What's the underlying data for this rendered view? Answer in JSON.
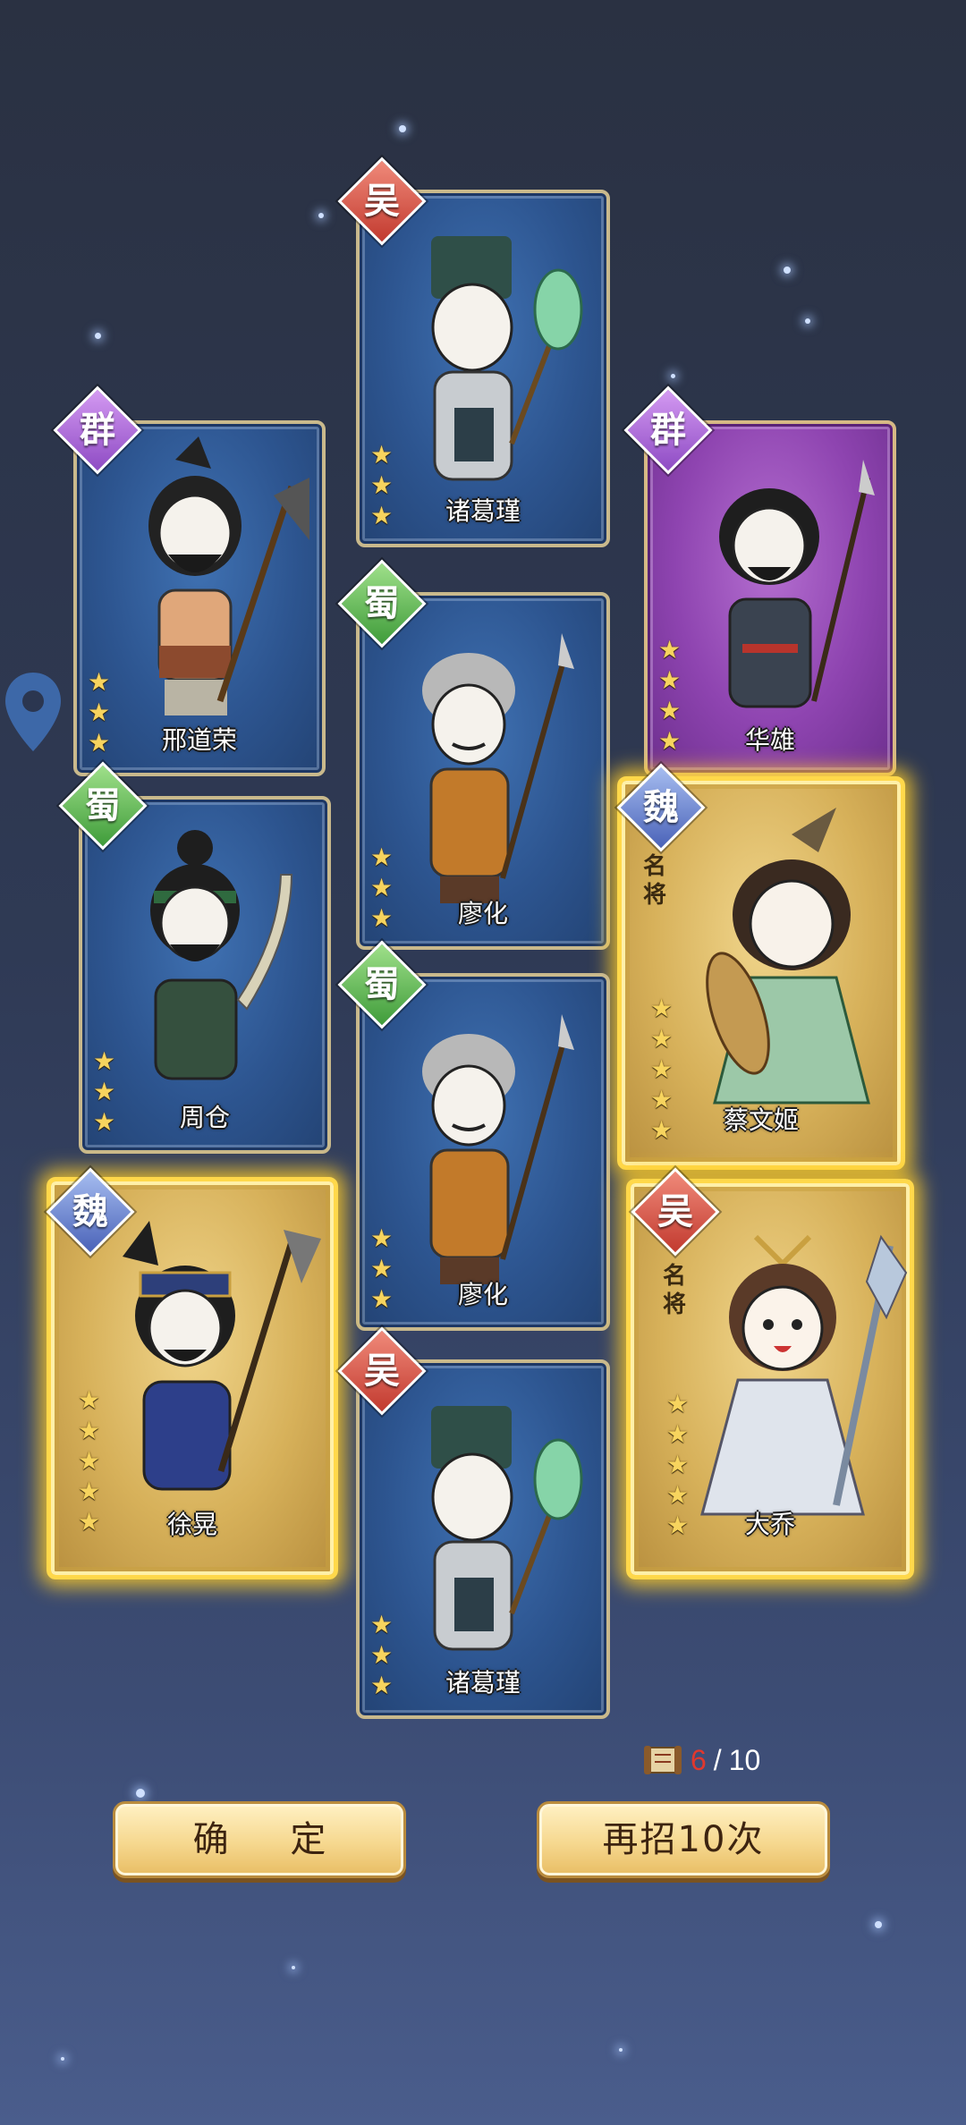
{
  "cards": [
    {
      "id": "c1",
      "name": "诸葛瑾",
      "faction": "吴",
      "frame": "blue",
      "stars": 3,
      "featured": false
    },
    {
      "id": "c2",
      "name": "邢道荣",
      "faction": "群",
      "frame": "blue",
      "stars": 3,
      "featured": false
    },
    {
      "id": "c3",
      "name": "华雄",
      "faction": "群",
      "frame": "purple",
      "stars": 4,
      "featured": false
    },
    {
      "id": "c4",
      "name": "廖化",
      "faction": "蜀",
      "frame": "blue",
      "stars": 3,
      "featured": false
    },
    {
      "id": "c5",
      "name": "周仓",
      "faction": "蜀",
      "frame": "blue",
      "stars": 3,
      "featured": false
    },
    {
      "id": "c6",
      "name": "蔡文姬",
      "faction": "魏",
      "frame": "gold",
      "stars": 5,
      "featured": true,
      "tag": "名将"
    },
    {
      "id": "c7",
      "name": "廖化",
      "faction": "蜀",
      "frame": "blue",
      "stars": 3,
      "featured": false
    },
    {
      "id": "c8",
      "name": "徐晃",
      "faction": "魏",
      "frame": "gold",
      "stars": 5,
      "featured": false
    },
    {
      "id": "c9",
      "name": "大乔",
      "faction": "吴",
      "frame": "gold",
      "stars": 5,
      "featured": true,
      "tag": "名将"
    },
    {
      "id": "c10",
      "name": "诸葛瑾",
      "faction": "吴",
      "frame": "blue",
      "stars": 3,
      "featured": false
    }
  ],
  "summon_counter": {
    "current": "6",
    "separator": "/",
    "total": "10",
    "icon": "scroll-icon"
  },
  "buttons": {
    "confirm": "确 定",
    "again": "再招10次"
  },
  "colors": {
    "gold_frame": "#ffd84a",
    "blue_frame": "#2d5590",
    "purple_frame": "#8e44b0",
    "counter_current": "#e0382e"
  },
  "icons": {
    "location": "location-pin-icon",
    "star": "star-icon"
  }
}
